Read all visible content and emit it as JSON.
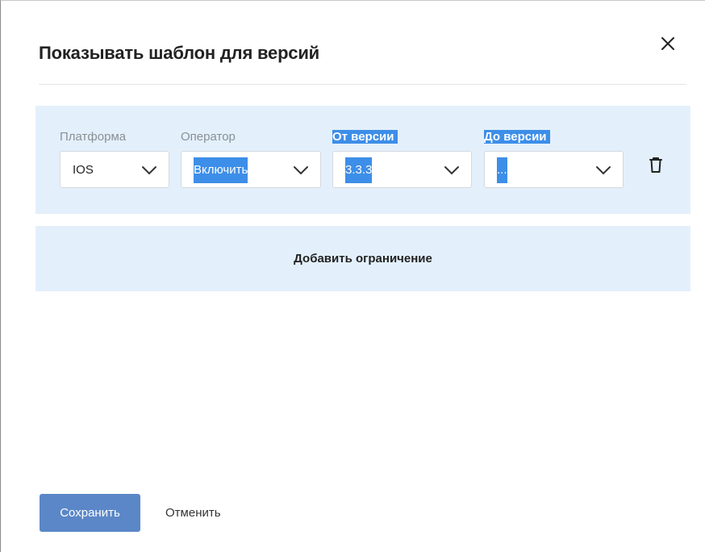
{
  "dialog": {
    "title": "Показывать шаблон для версий",
    "close_icon": "close-icon"
  },
  "rule": {
    "platform": {
      "label": "Платформа",
      "value": "IOS"
    },
    "operator": {
      "label": "Оператор",
      "value": "Включить"
    },
    "from_version": {
      "label": "От версии",
      "value": "3.3.3"
    },
    "to_version": {
      "label": "До версии",
      "value": "..."
    },
    "delete_icon": "trash-icon",
    "chevron_icon": "chevron-down-icon",
    "selection_color": "#3d8ee8",
    "panel_color": "#e3f0fb"
  },
  "add_constraint": {
    "label": "Добавить ограничение"
  },
  "footer": {
    "save_label": "Сохранить",
    "cancel_label": "Отменить",
    "save_color": "#5b87c8"
  }
}
